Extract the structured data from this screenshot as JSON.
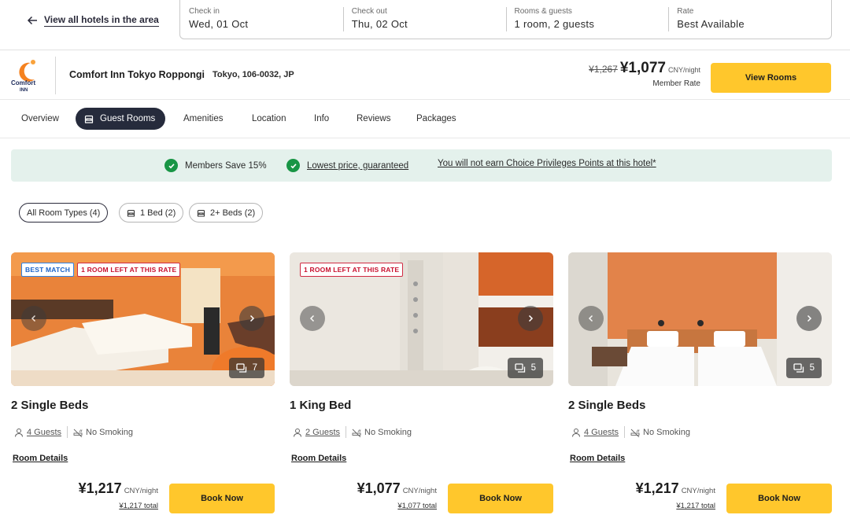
{
  "topbar": {
    "back_label": "View all hotels in the area",
    "fields": [
      {
        "label": "Check in",
        "value": "Wed, 01 Oct"
      },
      {
        "label": "Check out",
        "value": "Thu, 02 Oct"
      },
      {
        "label": "Rooms & guests",
        "value": "1 room, 2 guests"
      },
      {
        "label": "Rate",
        "value": "Best Available"
      }
    ]
  },
  "hotel": {
    "logo_text": "Comfort INN",
    "name": "Comfort Inn Tokyo Roppongi",
    "address": "Tokyo, 106-0032, JP",
    "old_price": "¥1,267",
    "price": "¥1,077",
    "price_unit": "CNY/night",
    "rate_label": "Member Rate",
    "view_rooms_label": "View Rooms"
  },
  "tabs": [
    {
      "label": "Overview"
    },
    {
      "label": "Guest Rooms",
      "active": true
    },
    {
      "label": "Amenities"
    },
    {
      "label": "Location"
    },
    {
      "label": "Info"
    },
    {
      "label": "Reviews"
    },
    {
      "label": "Packages"
    }
  ],
  "banner": {
    "members_save": "Members Save 15%",
    "lowest_price": "Lowest price, guaranteed",
    "no_points": "You will not earn Choice Privileges Points at this hotel*"
  },
  "filters": [
    {
      "label": "All Room Types (4)",
      "active": true
    },
    {
      "label": "1 Bed (2)"
    },
    {
      "label": "2+ Beds (2)"
    }
  ],
  "rooms": [
    {
      "title": "2 Single Beds",
      "badges": [
        "BEST MATCH",
        "1 ROOM LEFT AT THIS RATE"
      ],
      "photo_count": "7",
      "guests": "4 Guests",
      "smoking": "No Smoking",
      "details_label": "Room Details",
      "price": "¥1,217",
      "price_unit": "CNY/night",
      "total": "¥1,217 total",
      "book_label": "Book Now"
    },
    {
      "title": "1 King Bed",
      "badges": [
        "1 ROOM LEFT AT THIS RATE"
      ],
      "photo_count": "5",
      "guests": "2 Guests",
      "smoking": "No Smoking",
      "details_label": "Room Details",
      "price": "¥1,077",
      "price_unit": "CNY/night",
      "total": "¥1,077 total",
      "book_label": "Book Now"
    },
    {
      "title": "2 Single Beds",
      "badges": [],
      "photo_count": "5",
      "guests": "4 Guests",
      "smoking": "No Smoking",
      "details_label": "Room Details",
      "price": "¥1,217",
      "price_unit": "CNY/night",
      "total": "¥1,217 total",
      "book_label": "Book Now"
    }
  ],
  "colors": {
    "accent_yellow": "#ffc72c",
    "active_tab": "#262b3c",
    "banner_bg": "#e4f1ec",
    "check_green": "#189545",
    "badge_blue": "#1a63c9",
    "badge_red": "#c8102e",
    "logo_orange": "#f58220"
  }
}
